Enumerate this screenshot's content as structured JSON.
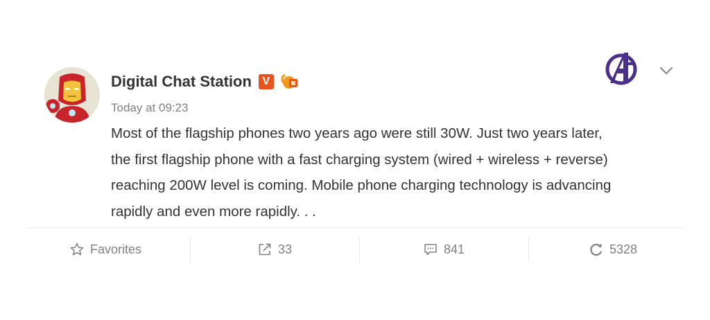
{
  "post": {
    "author": "Digital Chat Station",
    "verified_badge": "V",
    "timestamp": "Today at 09:23",
    "body_lines": [
      "Most of the flagship phones two years ago were still 30W. Just two years later,",
      "the first flagship phone with a fast charging system (wired + wireless + reverse)",
      "reaching 200W level is coming. Mobile phone charging technology is advancing",
      "rapidly and even more rapidly. . ."
    ]
  },
  "header_right": {
    "logo_icon": "avengers-logo-icon",
    "menu_icon": "chevron-down-icon"
  },
  "actions": {
    "favorites_label": "Favorites",
    "reposts_count": "33",
    "comments_count": "841",
    "likes_count": "5328"
  },
  "colors": {
    "text_primary": "#333333",
    "text_secondary": "#808080",
    "badge_orange": "#e8541e",
    "logo_purple": "#4b2f8a",
    "divider": "#ececec"
  }
}
